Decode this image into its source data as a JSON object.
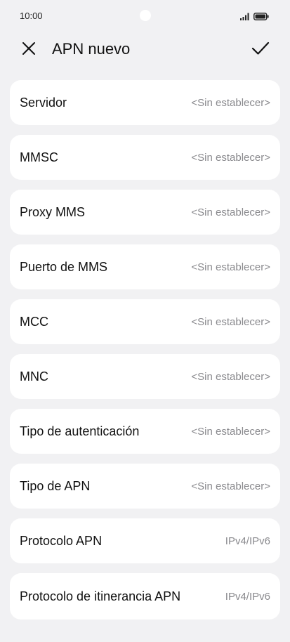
{
  "status_bar": {
    "time": "10:00"
  },
  "header": {
    "title": "APN nuevo",
    "close_icon": "close-icon",
    "confirm_icon": "check-icon"
  },
  "settings": [
    {
      "label": "Servidor",
      "value": "<Sin establecer>"
    },
    {
      "label": "MMSC",
      "value": "<Sin establecer>"
    },
    {
      "label": "Proxy MMS",
      "value": "<Sin establecer>"
    },
    {
      "label": "Puerto de MMS",
      "value": "<Sin establecer>"
    },
    {
      "label": "MCC",
      "value": "<Sin establecer>"
    },
    {
      "label": "MNC",
      "value": "<Sin establecer>"
    },
    {
      "label": "Tipo de autenticación",
      "value": "<Sin establecer>"
    },
    {
      "label": "Tipo de APN",
      "value": "<Sin establecer>"
    },
    {
      "label": "Protocolo APN",
      "value": "IPv4/IPv6"
    },
    {
      "label": "Protocolo de itinerancia APN",
      "value": "IPv4/IPv6"
    }
  ]
}
